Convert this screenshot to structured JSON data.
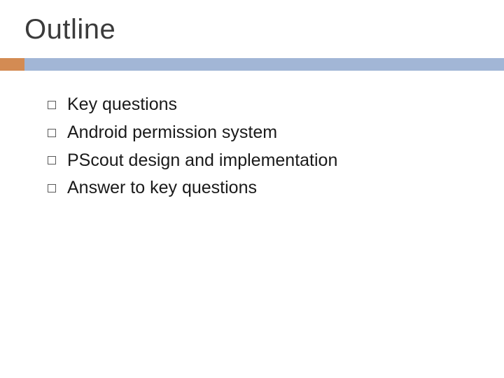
{
  "title": "Outline",
  "bullets": [
    {
      "text": "Key questions"
    },
    {
      "text": "Android permission system"
    },
    {
      "text": "PScout design and implementation"
    },
    {
      "text": "Answer to key questions"
    }
  ],
  "colors": {
    "accent": "#d38b53",
    "bar": "#a2b6d6"
  }
}
